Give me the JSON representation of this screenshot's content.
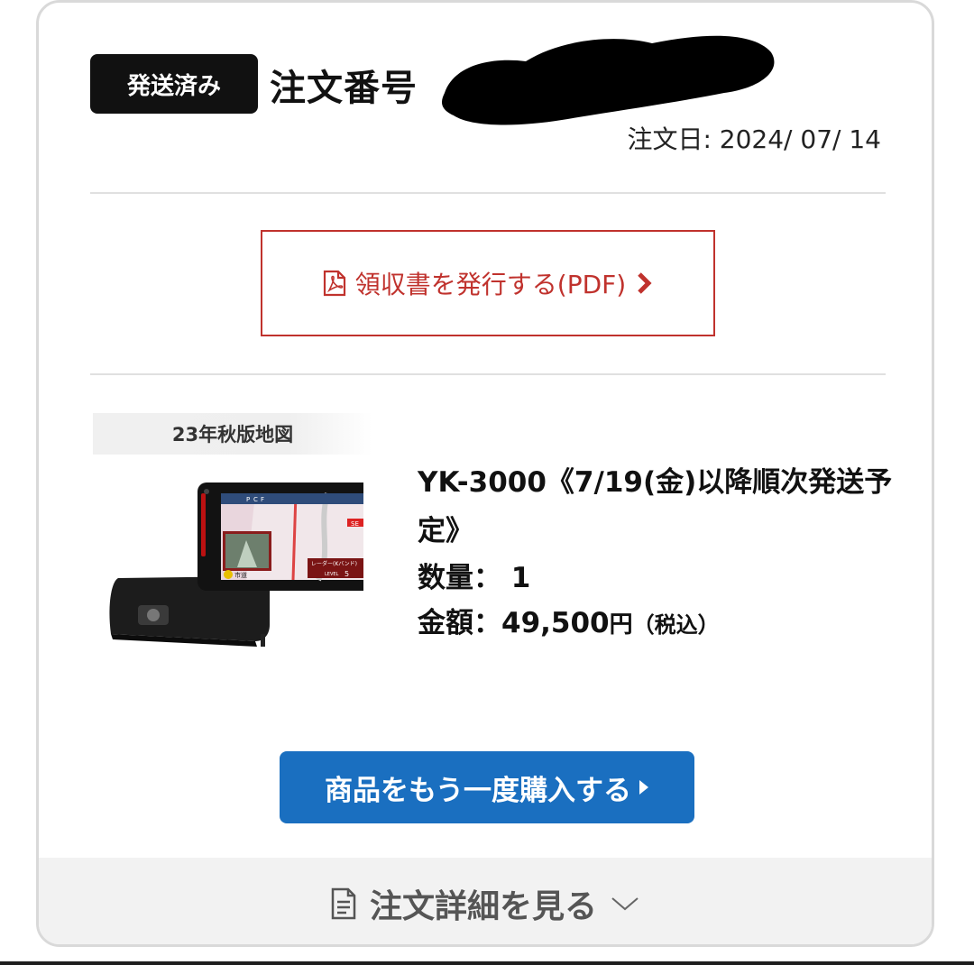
{
  "order": {
    "status_badge": "発送済み",
    "order_number_label": "注文番号",
    "order_date": "注文日: 2024/ 07/ 14"
  },
  "receipt": {
    "label": "領収書を発行する(PDF)"
  },
  "product": {
    "map_tag": "23年秋版地図",
    "name": "YK-3000《7/19(金)以降順次発送予定》",
    "quantity_label": "数量：",
    "quantity_value": "1",
    "price_label": "金額：",
    "price_value": "49,500",
    "price_unit": "円",
    "tax_note": "（税込）",
    "image_texts": [
      "P",
      "C",
      "F",
      "SE",
      "レーダー(Kバンド)",
      "LEVEL",
      "5",
      "市道"
    ]
  },
  "actions": {
    "rebuy_label": "商品をもう一度購入する",
    "details_label": "注文詳細を見る"
  },
  "colors": {
    "accent_red": "#c0322d",
    "button_blue": "#1a6fc0",
    "badge_black": "#111111"
  },
  "icons": {
    "receipt_icon": "pdf-file-icon",
    "receipt_arrow": "chevron-right-icon",
    "rebuy_arrow": "triangle-right-icon",
    "details_icon": "document-icon",
    "details_chevron": "chevron-down-icon"
  }
}
